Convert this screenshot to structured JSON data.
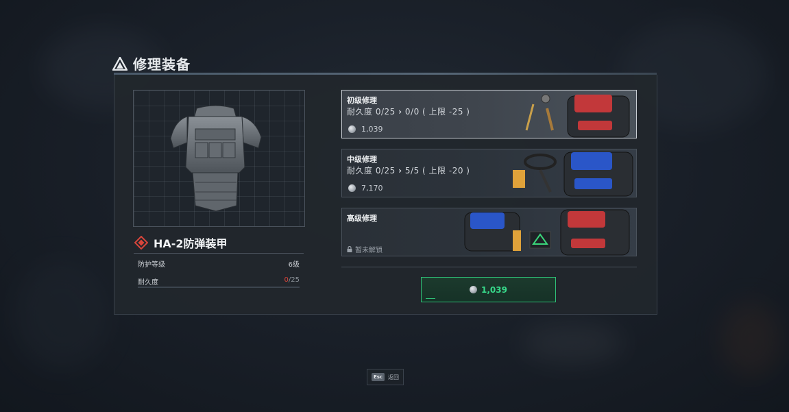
{
  "dialog": {
    "title": "修理装备",
    "title_icon": "triangle-logo-icon"
  },
  "item": {
    "name": "HA-2防弹装甲",
    "rarity_icon": "red-diamond-icon",
    "rarity_color": "#d8453b",
    "stats": [
      {
        "label": "防护等级",
        "value": "6级"
      },
      {
        "label": "耐久度",
        "current": "0",
        "separator": "/",
        "max": "25"
      }
    ],
    "durability_fraction": 0
  },
  "repair_options": [
    {
      "title": "初级修理",
      "durability_label": "耐久度",
      "from": "0/25",
      "arrow": "›",
      "to": "0/0",
      "limit": "( 上限 -25 )",
      "cost": "1,039",
      "selected": true
    },
    {
      "title": "中级修理",
      "durability_label": "耐久度",
      "from": "0/25",
      "arrow": "›",
      "to": "5/5",
      "limit": "( 上限 -20 )",
      "cost": "7,170",
      "selected": false
    },
    {
      "title": "高级修理",
      "lock_text": "暂未解锁",
      "locked": true
    }
  ],
  "buy_button": {
    "amount": "1,039",
    "color": "#37d98a"
  },
  "footer": {
    "key": "Esc",
    "label": "返回"
  },
  "colors": {
    "accent_green": "#2fbf77",
    "warning_red": "#d8453b",
    "panel_bg": "#22272d"
  }
}
